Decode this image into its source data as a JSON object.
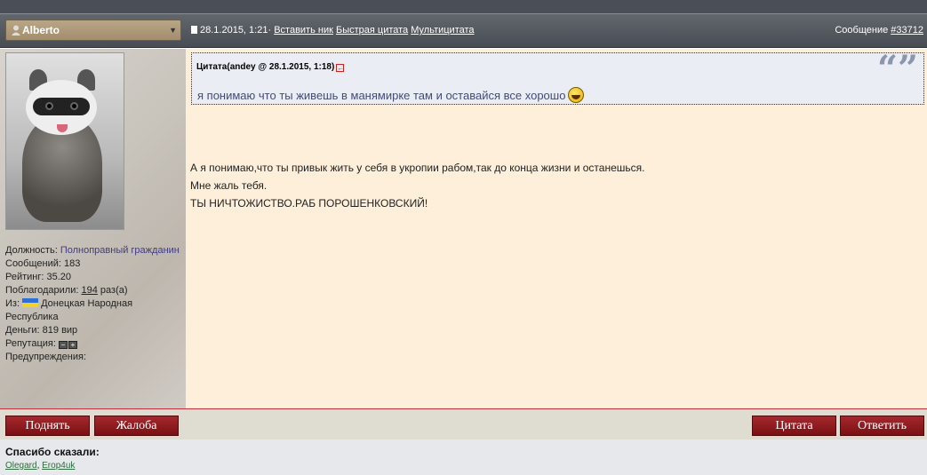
{
  "header": {
    "username": "Alberto",
    "date": "28.1.2015, 1:21",
    "separator": "·",
    "insert_nick": "Вставить ник",
    "quick_quote": "Быстрая цитата",
    "multi_quote": "Мультицитата",
    "message_label": "Сообщение",
    "message_number": "#33712"
  },
  "user": {
    "position_label": "Должность:",
    "position_value": "Полноправный гражданин",
    "messages_label": "Сообщений:",
    "messages_value": "183",
    "rating_label": "Рейтинг:",
    "rating_value": "35.20",
    "thanked_label": "Поблагодарили:",
    "thanked_value": "194",
    "thanked_suffix": "раз(а)",
    "from_label": "Из:",
    "from_value": "Донецкая Народная Республика",
    "money_label": "Деньги:",
    "money_value": "819 вир",
    "reputation_label": "Репутация:",
    "warnings_label": "Предупреждения:"
  },
  "quote": {
    "header": "Цитата(andey @ 28.1.2015, 1:18)",
    "text": "я понимаю что ты живешь в манямирке там и оставайся все хорошо",
    "marks": "“”"
  },
  "post": {
    "lines": [
      "А я понимаю,что ты привык жить у себя в укропии рабом,так до конца жизни и останешься.",
      "Мне жаль тебя.",
      "ТЫ НИЧТОЖИСТВО.РАБ ПОРОШЕНКОВСКИЙ!"
    ]
  },
  "buttons": {
    "raise": "Поднять",
    "complaint": "Жалоба",
    "quote": "Цитата",
    "reply": "Ответить"
  },
  "thanks": {
    "title": "Спасибо сказали:",
    "users": [
      "Olegard",
      "Erop4uk"
    ],
    "separator": ","
  },
  "colors": {
    "accent": "#8a1a1e",
    "content_bg": "#fdefd9",
    "quote_bg": "#eaeef4"
  }
}
